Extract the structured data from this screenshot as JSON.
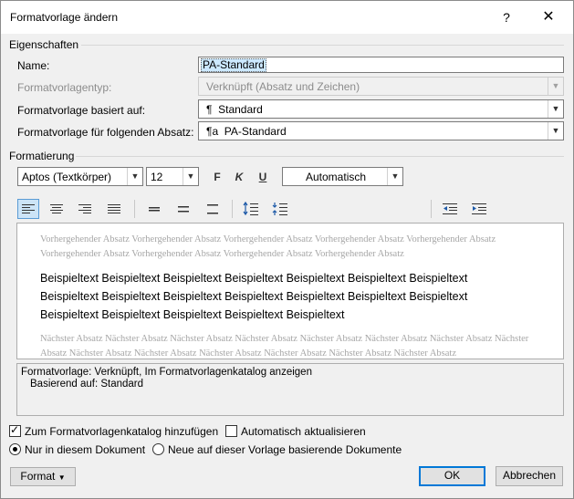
{
  "window": {
    "title": "Formatvorlage ändern",
    "help": "?",
    "close": "✕"
  },
  "properties": {
    "section": "Eigenschaften",
    "name_label": "Name:",
    "name_value": "PA-Standard",
    "type_label": "Formatvorlagentyp:",
    "type_value": "Verknüpft (Absatz und Zeichen)",
    "based_label": "Formatvorlage basiert auf:",
    "based_value": "Standard",
    "next_label": "Formatvorlage für folgenden Absatz:",
    "next_value": "PA-Standard"
  },
  "formatting": {
    "section": "Formatierung",
    "font": "Aptos (Textkörper)",
    "size": "12",
    "bold": "F",
    "italic": "K",
    "underline": "U",
    "color": "Automatisch"
  },
  "preview": {
    "prev_paragraph": "Vorhergehender Absatz Vorhergehender Absatz Vorhergehender Absatz Vorhergehender Absatz Vorhergehender Absatz Vorhergehender Absatz Vorhergehender Absatz Vorhergehender Absatz Vorhergehender Absatz",
    "sample_lines": [
      "Beispieltext Beispieltext Beispieltext Beispieltext Beispieltext Beispieltext Beispieltext",
      "Beispieltext Beispieltext Beispieltext Beispieltext Beispieltext Beispieltext Beispieltext",
      "Beispieltext Beispieltext Beispieltext Beispieltext Beispieltext"
    ],
    "next_paragraph": "Nächster Absatz Nächster Absatz Nächster Absatz Nächster Absatz Nächster Absatz Nächster Absatz Nächster Absatz Nächster Absatz Nächster Absatz Nächster Absatz Nächster Absatz Nächster Absatz Nächster Absatz Nächster Absatz"
  },
  "description": {
    "line1": "Formatvorlage: Verknüpft, Im Formatvorlagenkatalog anzeigen",
    "line2": "Basierend auf: Standard"
  },
  "options": {
    "add_to_gallery": "Zum Formatvorlagenkatalog hinzufügen",
    "auto_update": "Automatisch aktualisieren",
    "only_this_doc": "Nur in diesem Dokument",
    "new_docs": "Neue auf dieser Vorlage basierende Dokumente"
  },
  "buttons": {
    "format": "Format",
    "ok": "OK",
    "cancel": "Abbrechen"
  },
  "colors": {
    "accent": "#0078d7",
    "selection": "#cce8ff"
  }
}
